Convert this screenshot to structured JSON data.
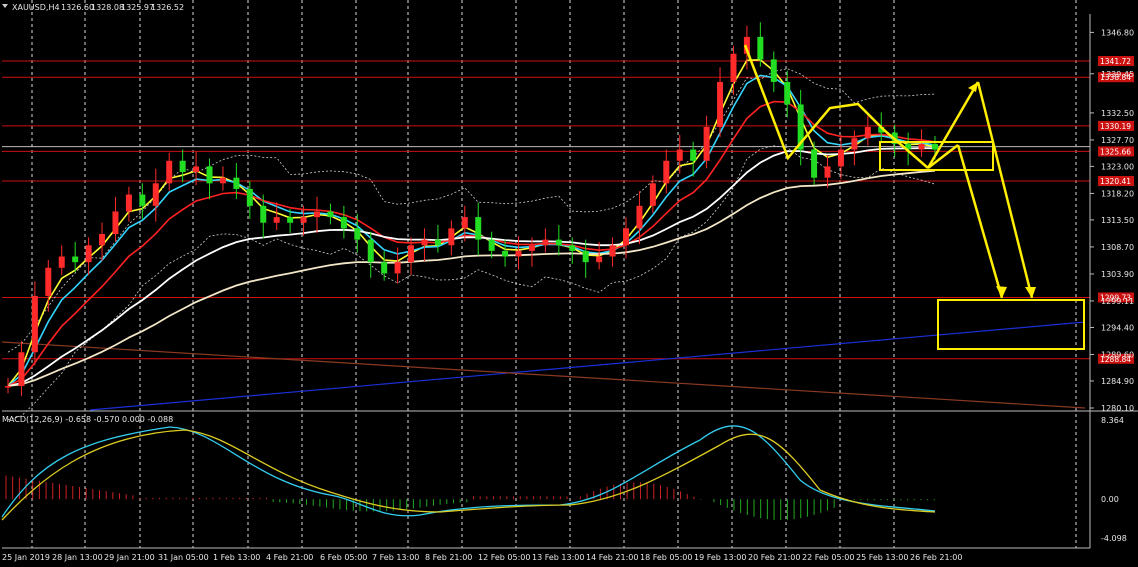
{
  "chart_data": {
    "type": "candlestick",
    "header": {
      "symbol": "XAUUSD,H4",
      "open": "1326.60",
      "high": "1328.08",
      "low": "1325.97",
      "close": "1326.52"
    },
    "macd_label": "MACD(12,26,9) -0.658 -0.570 0.000 -0.088",
    "price_axis": {
      "ylim": [
        1280.1,
        1349.0
      ],
      "ticks": [
        "1346.80",
        "1339.45",
        "1332.50",
        "1327.70",
        "1323.00",
        "1318.20",
        "1313.50",
        "1308.70",
        "1303.90",
        "1299.11",
        "1294.40",
        "1289.60",
        "1284.90",
        "1280.10"
      ]
    },
    "macd_axis": {
      "ylim": [
        -4.098,
        8.364
      ],
      "ticks": [
        "8.364",
        "0.00",
        "-4.098"
      ]
    },
    "resistance_levels": [
      {
        "value": 1341.72,
        "label": "1341.72"
      },
      {
        "value": 1338.84,
        "label": "1338.84"
      },
      {
        "value": 1330.19,
        "label": "1330.19"
      },
      {
        "value": 1325.66,
        "label": "1325.66"
      },
      {
        "value": 1320.41,
        "label": "1320.41"
      },
      {
        "value": 1299.73,
        "label": "1299.73"
      },
      {
        "value": 1288.84,
        "label": "1288.84"
      }
    ],
    "current_price": "1326.52",
    "x_labels": [
      "25 Jan 2019",
      "28 Jan 13:00",
      "29 Jan 21:00",
      "31 Jan 05:00",
      "1 Feb 13:00",
      "4 Feb 21:00",
      "6 Feb 05:00",
      "7 Feb 13:00",
      "8 Feb 21:00",
      "12 Feb 05:00",
      "13 Feb 13:00",
      "14 Feb 21:00",
      "18 Feb 05:00",
      "19 Feb 13:00",
      "20 Feb 21:00",
      "22 Feb 05:00",
      "25 Feb 13:00",
      "26 Feb 21:00"
    ],
    "close_path": [
      1284,
      1290,
      1300,
      1305,
      1307,
      1306,
      1309,
      1311,
      1315,
      1318,
      1316,
      1320,
      1324,
      1322,
      1323,
      1320,
      1321,
      1319,
      1316,
      1313,
      1314,
      1313,
      1314,
      1315,
      1314,
      1312,
      1310,
      1306,
      1304,
      1306,
      1309,
      1310,
      1309,
      1312,
      1314,
      1310,
      1308,
      1307,
      1308,
      1309,
      1310,
      1309,
      1308,
      1306,
      1307,
      1309,
      1312,
      1316,
      1320,
      1324,
      1326,
      1324,
      1330,
      1338,
      1343,
      1346,
      1342,
      1338,
      1334,
      1326,
      1321,
      1323,
      1326,
      1328,
      1330,
      1329,
      1327,
      1326,
      1327,
      1326
    ]
  }
}
